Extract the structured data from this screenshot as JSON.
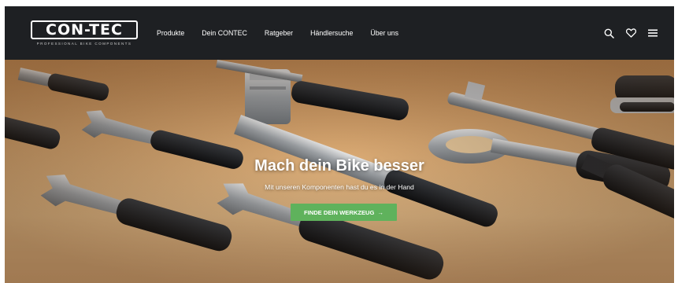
{
  "logo": {
    "brand": "CON-TEC",
    "tagline": "PROFESSIONAL BIKE COMPONENTS"
  },
  "nav": {
    "items": [
      {
        "label": "Produkte"
      },
      {
        "label": "Dein CONTEC"
      },
      {
        "label": "Ratgeber"
      },
      {
        "label": "Händlersuche"
      },
      {
        "label": "Über uns"
      }
    ]
  },
  "header_icons": [
    "search-icon",
    "heart-icon",
    "menu-icon"
  ],
  "hero": {
    "title": "Mach dein Bike besser",
    "subtitle": "Mit unseren Komponenten hast du es in der Hand",
    "cta_label": "FINDE DEIN WERKZEUG",
    "cta_arrow": "→"
  },
  "colors": {
    "header_bg": "#1e2023",
    "cta_bg": "#5fb25c",
    "text": "#ffffff"
  }
}
